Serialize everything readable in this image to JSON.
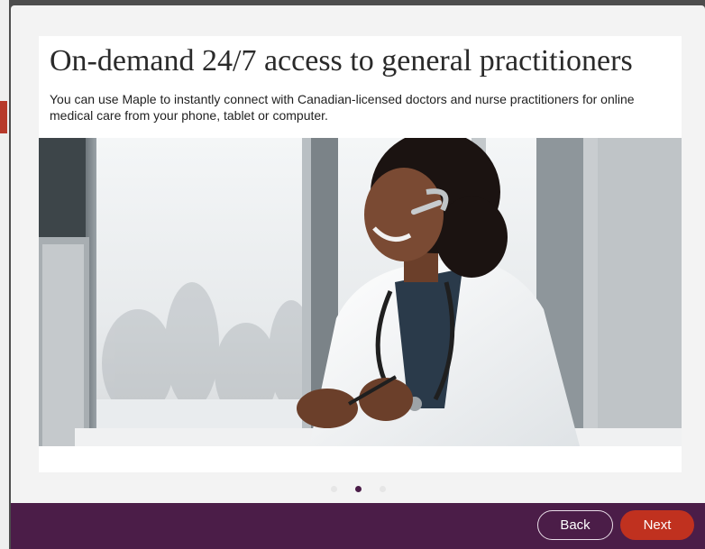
{
  "slide": {
    "title": "On-demand 24/7 access to general practitioners",
    "description": "You can use Maple to instantly connect with Canadian-licensed doctors and nurse practitioners for online medical care from your phone, tablet or computer."
  },
  "carousel": {
    "total": 3,
    "active_index": 1
  },
  "footer": {
    "back_label": "Back",
    "next_label": "Next"
  },
  "colors": {
    "brand_purple": "#4b1d48",
    "accent_red": "#c0311f"
  }
}
